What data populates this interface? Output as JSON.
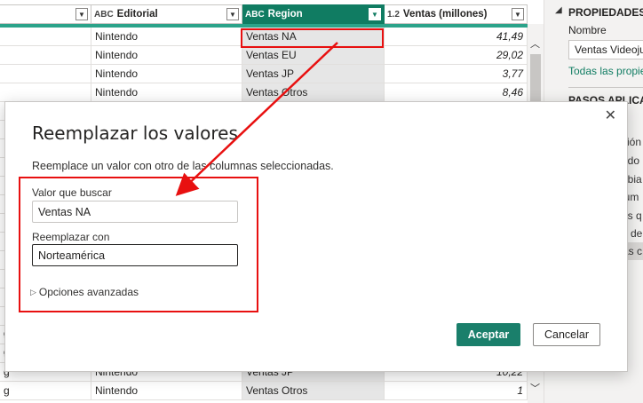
{
  "grid": {
    "columns": [
      {
        "type": "",
        "label": ""
      },
      {
        "type": "ABC",
        "label": "Editorial"
      },
      {
        "type": "ABC",
        "label": "Region"
      },
      {
        "type": "1.2",
        "label": "Ventas (millones)"
      }
    ],
    "rows_top": [
      {
        "c0": "",
        "c1": "Nintendo",
        "c2": "Ventas NA",
        "c3": "41,49"
      },
      {
        "c0": "",
        "c1": "Nintendo",
        "c2": "Ventas EU",
        "c3": "29,02"
      },
      {
        "c0": "",
        "c1": "Nintendo",
        "c2": "Ventas JP",
        "c3": "3,77"
      },
      {
        "c0": "",
        "c1": "Nintendo",
        "c2": "Ventas Otros",
        "c3": "8,46"
      }
    ],
    "rows_bottom": [
      {
        "c0": "g",
        "c1": "Nintendo",
        "c2": "Ventas JP",
        "c3": "10,22"
      },
      {
        "c0": "g",
        "c1": "Nintendo",
        "c2": "Ventas Otros",
        "c3": "1"
      }
    ],
    "left_edge_fragments": [
      "g",
      "g"
    ]
  },
  "panel": {
    "properties_title": "PROPIEDADES",
    "name_label": "Nombre",
    "name_value": "Ventas Videojuegos",
    "all_properties_link": "Todas las propiedades",
    "applied_steps_title": "PASOS APLICADOS",
    "steps": [
      "ción",
      "ado",
      "nbia",
      "lum",
      "as q",
      "a de",
      "as c"
    ]
  },
  "dialog": {
    "title": "Reemplazar los valores",
    "description": "Reemplace un valor con otro de las columnas seleccionadas.",
    "find_label": "Valor que buscar",
    "find_value": "Ventas NA",
    "replace_label": "Reemplazar con",
    "replace_value": "Norteamérica",
    "advanced_label": "Opciones avanzadas",
    "ok_label": "Aceptar",
    "cancel_label": "Cancelar",
    "close_glyph": "✕"
  },
  "colors": {
    "accent": "#107c62",
    "annotation": "#e81010"
  }
}
